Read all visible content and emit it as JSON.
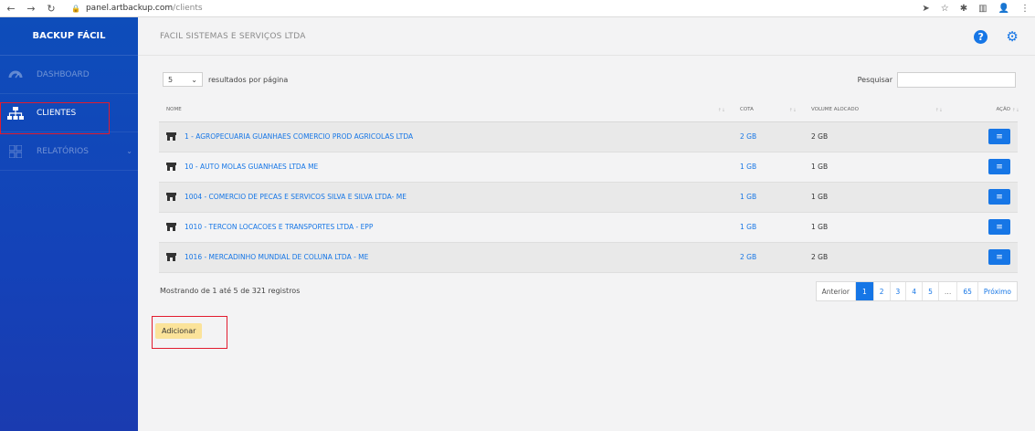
{
  "browser": {
    "url_host": "panel.artbackup.com",
    "url_path": "/clients"
  },
  "sidebar": {
    "brand": "BACKUP FÁCIL",
    "items": [
      {
        "label": "DASHBOARD",
        "icon": "dashboard-icon"
      },
      {
        "label": "CLIENTES",
        "icon": "sitemap-icon",
        "active": true
      },
      {
        "label": "RELATÓRIOS",
        "icon": "grid-icon"
      }
    ]
  },
  "header": {
    "title": "FACIL SISTEMAS E SERVIÇOS LTDA"
  },
  "controls": {
    "page_size": "5",
    "page_size_label": "resultados por página",
    "search_label": "Pesquisar",
    "search_value": ""
  },
  "table": {
    "columns": [
      "NOME",
      "COTA",
      "VOLUME ALOCADO",
      "AÇÃO"
    ],
    "rows": [
      {
        "name": "1 - AGROPECUARIA GUANHAES COMERCIO PROD AGRICOLAS LTDA",
        "quota": "2 GB",
        "allocated": "2 GB"
      },
      {
        "name": "10 - AUTO MOLAS GUANHAES LTDA ME",
        "quota": "1 GB",
        "allocated": "1 GB"
      },
      {
        "name": "1004 - COMERCIO DE PECAS E SERVICOS SILVA E SILVA LTDA- ME",
        "quota": "1 GB",
        "allocated": "1 GB"
      },
      {
        "name": "1010 - TERCON LOCACOES E TRANSPORTES LTDA - EPP",
        "quota": "1 GB",
        "allocated": "1 GB"
      },
      {
        "name": "1016 - MERCADINHO MUNDIAL DE COLUNA LTDA - ME",
        "quota": "2 GB",
        "allocated": "2 GB"
      }
    ]
  },
  "footer": {
    "info": "Mostrando de 1 até 5 de 321 registros",
    "pager": [
      "Anterior",
      "1",
      "2",
      "3",
      "4",
      "5",
      "…",
      "65",
      "Próximo"
    ],
    "current_page": "1",
    "add_label": "Adicionar"
  },
  "colors": {
    "sidebar": "#1442b8",
    "accent": "#1676e6",
    "add_button": "#fbe39a",
    "highlight": "#e21b2e"
  }
}
